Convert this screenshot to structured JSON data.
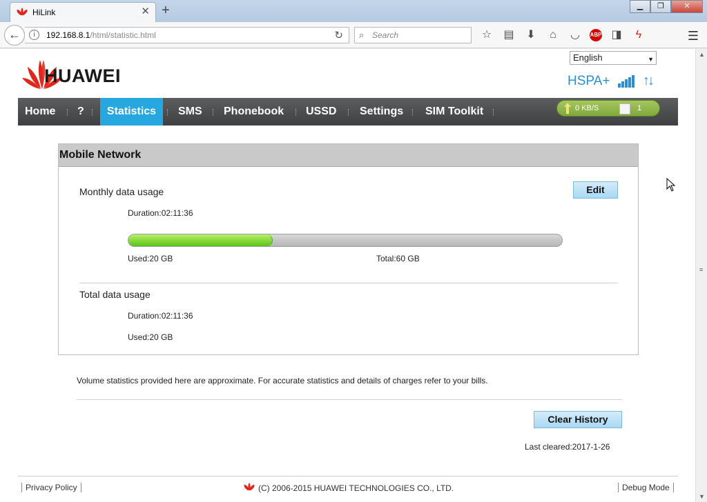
{
  "browser": {
    "tab_title": "HiLink",
    "url_host": "192.168.8.1",
    "url_path": "/html/statistic.html",
    "search_placeholder": "Search",
    "close_glyph": "✕",
    "new_tab_glyph": "+",
    "minimize_glyph": "▁",
    "maximize_glyph": "❐",
    "close_window_glyph": "✕"
  },
  "header": {
    "brand": "HUAWEI",
    "language": "English",
    "network_type": "HSPA+",
    "colors": {
      "accent": "#26a7e0",
      "brand": "#e1261c",
      "network": "#2b8fd6"
    }
  },
  "nav": {
    "items": [
      {
        "label": "Home"
      },
      {
        "label": "?"
      },
      {
        "label": "Statistics",
        "active": true
      },
      {
        "label": "SMS"
      },
      {
        "label": "Phonebook"
      },
      {
        "label": "USSD"
      },
      {
        "label": "Settings"
      },
      {
        "label": "SIM Toolkit"
      }
    ],
    "speed": "0 KB/S",
    "sms_count": "1"
  },
  "panel": {
    "title": "Mobile Network",
    "monthly_label": "Monthly data usage",
    "edit_label": "Edit",
    "monthly_duration": "Duration:02:11:36",
    "monthly_used": "Used:20 GB",
    "monthly_total": "Total:60 GB",
    "usage_fraction": 0.333,
    "total_label": "Total data usage",
    "total_duration": "Duration:02:11:36",
    "total_used": "Used:20 GB"
  },
  "notice": "Volume statistics provided here are approximate. For accurate statistics and details of charges refer to your bills.",
  "clear_history_label": "Clear History",
  "last_cleared": "Last cleared:2017-1-26",
  "footer": {
    "privacy": "Privacy Policy",
    "copyright": "(C) 2006-2015 HUAWEI TECHNOLOGIES CO., LTD.",
    "debug": "Debug Mode"
  }
}
